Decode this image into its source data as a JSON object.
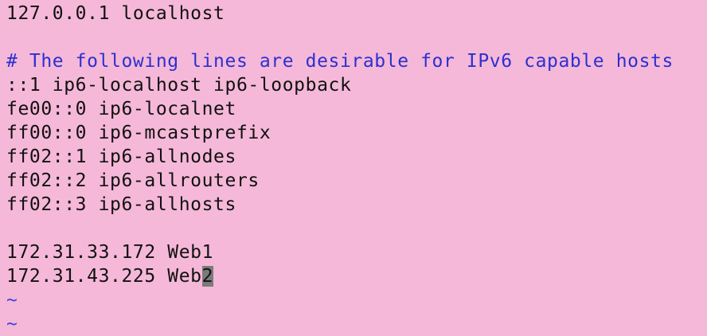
{
  "editor": {
    "lines": [
      {
        "text": "127.0.0.1 localhost"
      },
      {
        "text": ""
      },
      {
        "text": "# The following lines are desirable for IPv6 capable hosts"
      },
      {
        "text": "::1 ip6-localhost ip6-loopback"
      },
      {
        "text": "fe00::0 ip6-localnet"
      },
      {
        "text": "ff00::0 ip6-mcastprefix"
      },
      {
        "text": "ff02::1 ip6-allnodes"
      },
      {
        "text": "ff02::2 ip6-allrouters"
      },
      {
        "text": "ff02::3 ip6-allhosts"
      },
      {
        "text": ""
      },
      {
        "text": "172.31.33.172 Web1"
      },
      {
        "before_cursor": "172.31.43.225 Web",
        "cursor_char": "2"
      },
      {
        "text": "~"
      },
      {
        "text": "~"
      }
    ]
  },
  "colors": {
    "background": "#f5b8d8",
    "comment": "#2d2fd1",
    "tilde": "#3a46e0",
    "cursor": "#7b7b7b"
  }
}
